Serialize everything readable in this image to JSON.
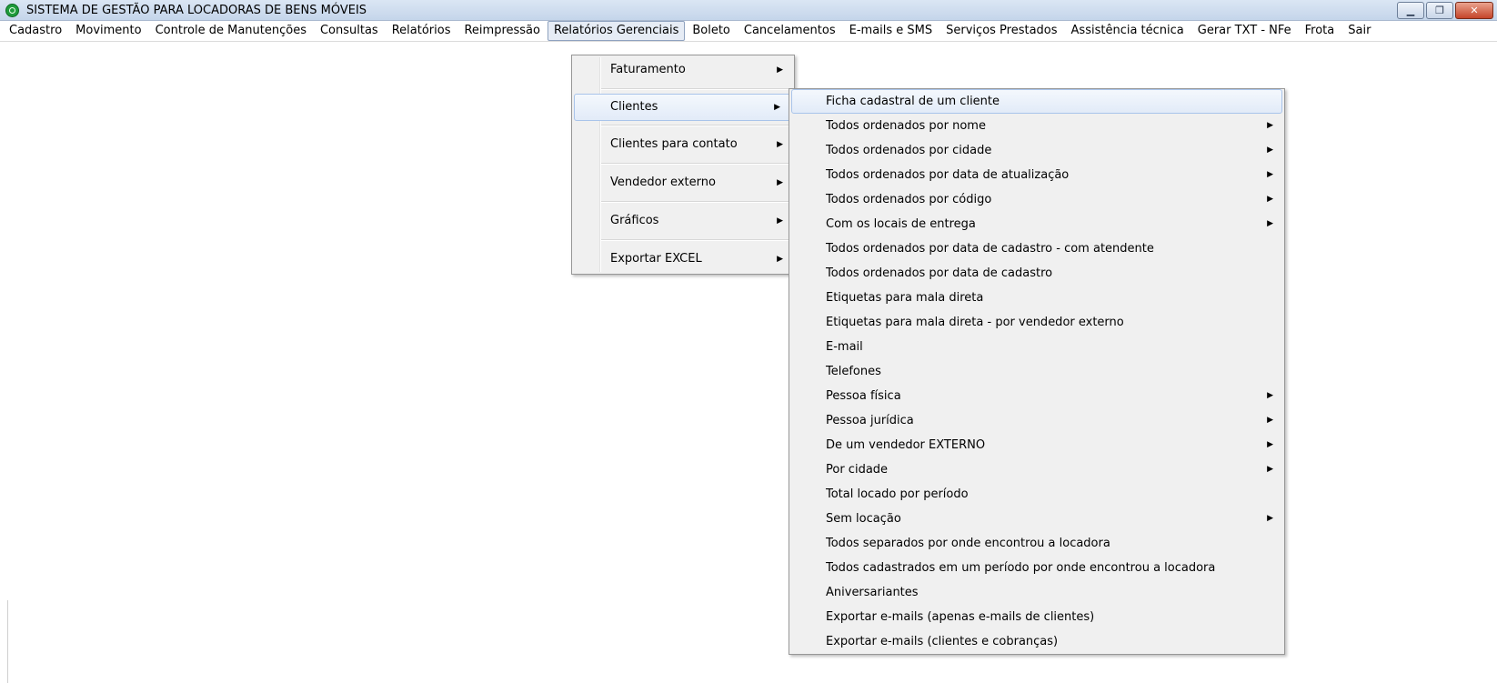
{
  "window": {
    "title": "SISTEMA DE GESTÃO PARA LOCADORAS DE BENS MÓVEIS",
    "controls": {
      "minimize": "▁",
      "maximize": "❐",
      "close": "✕"
    }
  },
  "menubar": {
    "items": [
      {
        "label": "Cadastro"
      },
      {
        "label": "Movimento"
      },
      {
        "label": "Controle de Manutenções"
      },
      {
        "label": "Consultas"
      },
      {
        "label": "Relatórios"
      },
      {
        "label": "Reimpressão"
      },
      {
        "label": "Relatórios Gerenciais"
      },
      {
        "label": "Boleto"
      },
      {
        "label": "Cancelamentos"
      },
      {
        "label": "E-mails e SMS"
      },
      {
        "label": "Serviços Prestados"
      },
      {
        "label": "Assistência técnica"
      },
      {
        "label": "Gerar TXT - NFe"
      },
      {
        "label": "Frota"
      },
      {
        "label": "Sair"
      }
    ]
  },
  "relatorios_gerenciais_menu": {
    "items": [
      {
        "label": "Faturamento",
        "submenu": true
      },
      {
        "label": "Clientes",
        "submenu": true
      },
      {
        "label": "Clientes para contato",
        "submenu": true
      },
      {
        "label": "Vendedor externo",
        "submenu": true
      },
      {
        "label": "Gráficos",
        "submenu": true
      },
      {
        "label": "Exportar EXCEL",
        "submenu": true
      }
    ]
  },
  "clientes_menu": {
    "items": [
      {
        "label": "Ficha cadastral de um cliente",
        "submenu": false
      },
      {
        "label": "Todos ordenados por nome",
        "submenu": true
      },
      {
        "label": "Todos ordenados por cidade",
        "submenu": true
      },
      {
        "label": "Todos ordenados por data de atualização",
        "submenu": true
      },
      {
        "label": "Todos ordenados por código",
        "submenu": true
      },
      {
        "label": "Com os locais de entrega",
        "submenu": true
      },
      {
        "label": "Todos ordenados por data de cadastro - com atendente",
        "submenu": false
      },
      {
        "label": "Todos ordenados por data de cadastro",
        "submenu": false
      },
      {
        "label": "Etiquetas para mala direta",
        "submenu": false
      },
      {
        "label": "Etiquetas para mala direta - por vendedor externo",
        "submenu": false
      },
      {
        "label": "E-mail",
        "submenu": false
      },
      {
        "label": "Telefones",
        "submenu": false
      },
      {
        "label": "Pessoa física",
        "submenu": true
      },
      {
        "label": "Pessoa jurídica",
        "submenu": true
      },
      {
        "label": "De um vendedor EXTERNO",
        "submenu": true
      },
      {
        "label": "Por cidade",
        "submenu": true
      },
      {
        "label": "Total locado por período",
        "submenu": false
      },
      {
        "label": "Sem locação",
        "submenu": true
      },
      {
        "label": "Todos separados por onde encontrou a locadora",
        "submenu": false
      },
      {
        "label": "Todos cadastrados em um período por onde encontrou a locadora",
        "submenu": false
      },
      {
        "label": "Aniversariantes",
        "submenu": false
      },
      {
        "label": "Exportar e-mails (apenas e-mails de clientes)",
        "submenu": false
      },
      {
        "label": "Exportar e-mails (clientes e cobranças)",
        "submenu": false
      }
    ]
  }
}
